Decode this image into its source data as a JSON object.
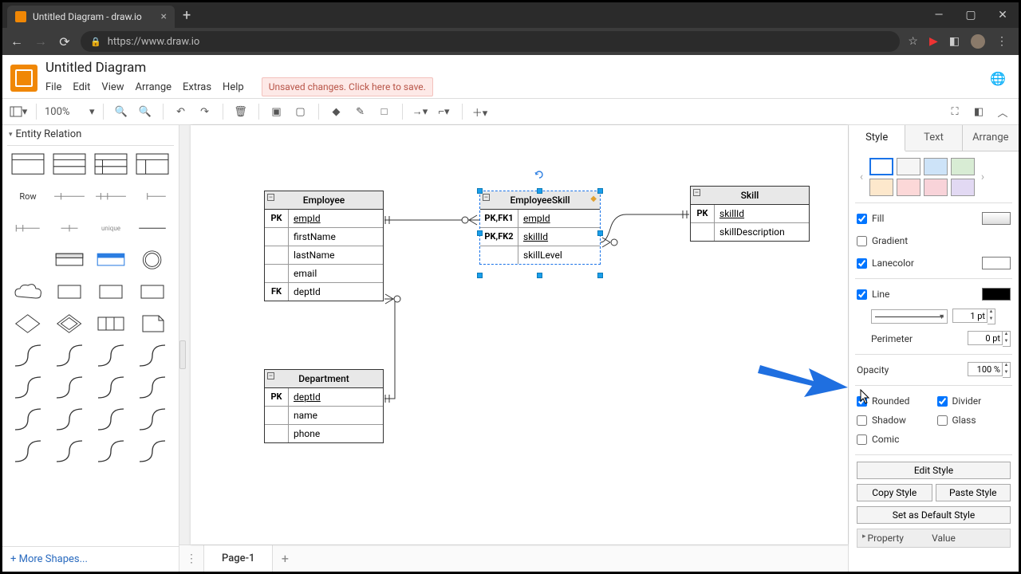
{
  "browser": {
    "tab_title": "Untitled Diagram - draw.io",
    "url": "https://www.draw.io"
  },
  "app": {
    "title": "Untitled Diagram",
    "menus": [
      "File",
      "Edit",
      "View",
      "Arrange",
      "Extras",
      "Help"
    ],
    "unsaved_msg": "Unsaved changes. Click here to save."
  },
  "toolbar": {
    "zoom": "100%",
    "line_pt": "1 pt",
    "perimeter_pt": "0 pt",
    "opacity": "100 %"
  },
  "palette": {
    "section": "Entity Relation",
    "row_label": "Row",
    "more": "More Shapes..."
  },
  "pages": {
    "page1": "Page-1"
  },
  "entities": {
    "employee": {
      "title": "Employee",
      "rows": [
        [
          "PK",
          "empId",
          true
        ],
        [
          "",
          "firstName",
          false
        ],
        [
          "",
          "lastName",
          false
        ],
        [
          "",
          "email",
          false
        ],
        [
          "FK",
          "deptId",
          false
        ]
      ]
    },
    "employeeskill": {
      "title": "EmployeeSkill",
      "rows": [
        [
          "PK,FK1",
          "empId",
          true
        ],
        [
          "PK,FK2",
          "skillId",
          true
        ],
        [
          "",
          "skillLevel",
          false
        ]
      ]
    },
    "skill": {
      "title": "Skill",
      "rows": [
        [
          "PK",
          "skillId",
          true
        ],
        [
          "",
          "skillDescription",
          false
        ]
      ]
    },
    "department": {
      "title": "Department",
      "rows": [
        [
          "PK",
          "deptId",
          true
        ],
        [
          "",
          "name",
          false
        ],
        [
          "",
          "phone",
          false
        ]
      ]
    }
  },
  "panel": {
    "tabs": [
      "Style",
      "Text",
      "Arrange"
    ],
    "swatches_top": [
      "#ffffff",
      "#f5f5f5",
      "#cde3f8",
      "#d8ecd4"
    ],
    "swatches_bot": [
      "#fde8cc",
      "#fcd8d8",
      "#f8d3d9",
      "#e2d9f3"
    ],
    "checks": {
      "fill": true,
      "gradient": false,
      "lanecolor": true,
      "line": true,
      "rounded": true,
      "divider": true,
      "shadow": false,
      "glass": false,
      "comic": false
    },
    "labels": {
      "fill": "Fill",
      "gradient": "Gradient",
      "lanecolor": "Lanecolor",
      "line": "Line",
      "perimeter": "Perimeter",
      "opacity": "Opacity",
      "rounded": "Rounded",
      "divider": "Divider",
      "shadow": "Shadow",
      "glass": "Glass",
      "comic": "Comic",
      "editstyle": "Edit Style",
      "copystyle": "Copy Style",
      "pastestyle": "Paste Style",
      "setdefault": "Set as Default Style",
      "property": "Property",
      "value": "Value"
    },
    "fill_color": "#ffffff",
    "lane_color": "#ffffff",
    "line_color": "#000000"
  }
}
